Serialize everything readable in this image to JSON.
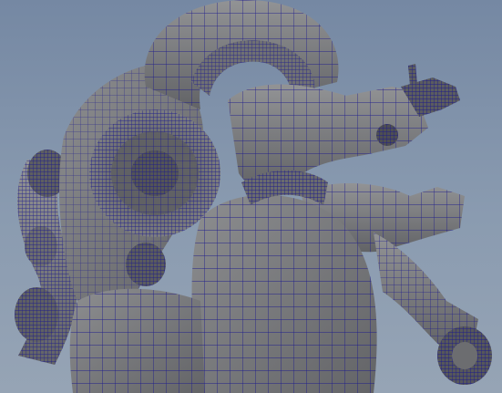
{
  "viewport": {
    "background_top": "#7588a3",
    "background_bottom": "#96a4b5",
    "shade_color": "#77787a",
    "shade_light": "#8d8e90",
    "shade_dark": "#5c5d60",
    "wire_color": "#1c1a8c",
    "wire_highlight": "#2f2bd0"
  },
  "model": {
    "icon": "mechanical-heart-mesh"
  }
}
